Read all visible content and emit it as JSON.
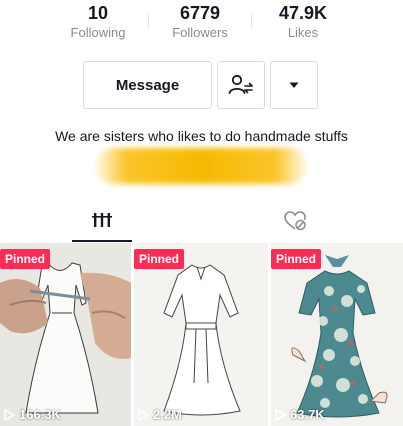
{
  "stats": [
    {
      "value": "10",
      "label": "Following"
    },
    {
      "value": "6779",
      "label": "Followers"
    },
    {
      "value": "47.9K",
      "label": "Likes"
    }
  ],
  "actions": {
    "message_label": "Message",
    "follow_icon": "person-swap-icon",
    "more_icon": "caret-down-icon"
  },
  "bio": {
    "text": "We are sisters who likes to do handmade stuffs"
  },
  "tabs": [
    {
      "icon": "grid-icon",
      "active": true
    },
    {
      "icon": "liked-hidden-icon",
      "active": false
    }
  ],
  "videos": [
    {
      "badge": "Pinned",
      "views": "166.3K"
    },
    {
      "badge": "Pinned",
      "views": "2.2M"
    },
    {
      "badge": "Pinned",
      "views": "63.7K"
    }
  ],
  "colors": {
    "accent": "#fe2c55",
    "text": "#161823",
    "muted": "#8a8b91"
  }
}
